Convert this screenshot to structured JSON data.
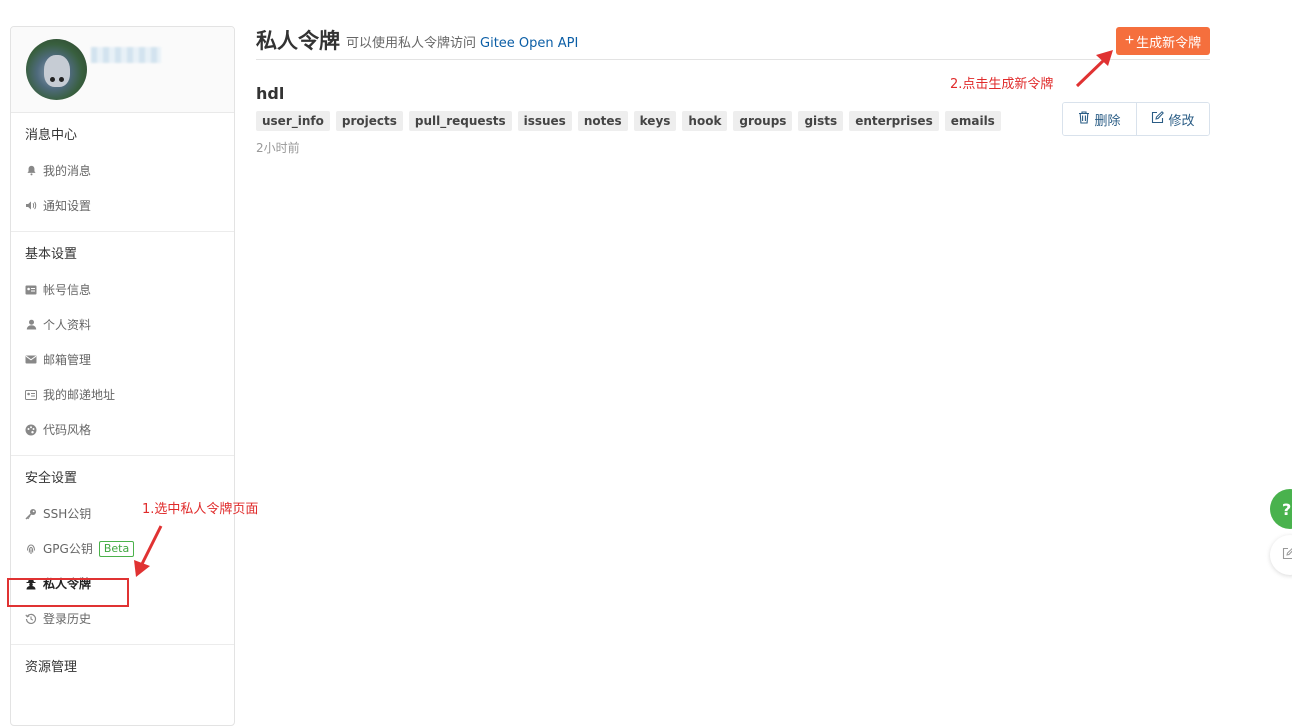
{
  "sidebar": {
    "sections": {
      "messages": {
        "title": "消息中心",
        "items": [
          {
            "label": "我的消息",
            "icon": "bell-icon"
          },
          {
            "label": "通知设置",
            "icon": "volume-icon"
          }
        ]
      },
      "basic": {
        "title": "基本设置",
        "items": [
          {
            "label": "帐号信息",
            "icon": "id-card-icon"
          },
          {
            "label": "个人资料",
            "icon": "user-icon"
          },
          {
            "label": "邮箱管理",
            "icon": "envelope-icon"
          },
          {
            "label": "我的邮递地址",
            "icon": "address-card-icon"
          },
          {
            "label": "代码风格",
            "icon": "palette-icon"
          }
        ]
      },
      "security": {
        "title": "安全设置",
        "items": [
          {
            "label": "SSH公钥",
            "icon": "key-icon"
          },
          {
            "label": "GPG公钥",
            "icon": "fingerprint-icon",
            "badge": "Beta"
          },
          {
            "label": "私人令牌",
            "icon": "user-secret-icon",
            "active": true
          },
          {
            "label": "登录历史",
            "icon": "history-icon"
          }
        ]
      },
      "resources": {
        "title": "资源管理"
      }
    }
  },
  "header": {
    "title": "私人令牌",
    "subtitle": "可以使用私人令牌访问",
    "api_link": "Gitee Open API",
    "new_button": "生成新令牌"
  },
  "token": {
    "name": "hdl",
    "scopes": [
      "user_info",
      "projects",
      "pull_requests",
      "issues",
      "notes",
      "keys",
      "hook",
      "groups",
      "gists",
      "enterprises",
      "emails"
    ],
    "time": "2小时前",
    "delete_label": "删除",
    "edit_label": "修改"
  },
  "annotations": {
    "step1": "1.选中私人令牌页面",
    "step2": "2.点击生成新令牌",
    "color": "#e02b2b"
  },
  "widgets": {
    "help": "?"
  },
  "colors": {
    "accent": "#f56f3d",
    "link": "#0b5ea6",
    "beta": "#3fa63f"
  }
}
